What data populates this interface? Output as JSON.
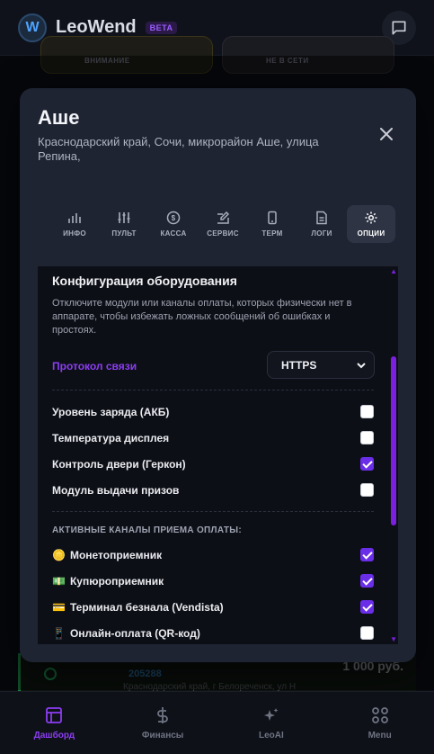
{
  "header": {
    "brand": "LeoWend",
    "beta": "BETA"
  },
  "background": {
    "status_cards": [
      {
        "label": "ВНИМАНИЕ"
      },
      {
        "label": "НЕ В СЕТИ"
      }
    ],
    "device": {
      "id": "205288",
      "price": "1 000 руб.",
      "address": "Краснодарский край, г Белореченск, ул Н"
    }
  },
  "modal": {
    "title": "Аше",
    "subtitle": "Краснодарский край, Сочи, микрорайон Аше, улица Репина,",
    "tabs": [
      {
        "label": "ИНФО",
        "icon": "bar-chart-icon"
      },
      {
        "label": "ПУЛЬТ",
        "icon": "sliders-icon"
      },
      {
        "label": "КАССА",
        "icon": "dollar-icon"
      },
      {
        "label": "СЕРВИС",
        "icon": "edit-icon"
      },
      {
        "label": "ТЕРМ",
        "icon": "phone-icon"
      },
      {
        "label": "ЛОГИ",
        "icon": "document-icon"
      },
      {
        "label": "ОПЦИИ",
        "icon": "gear-icon",
        "active": true
      }
    ],
    "config": {
      "title": "Конфигурация оборудования",
      "description": "Отключите модули или каналы оплаты, которых физически нет в аппарате, чтобы избежать ложных сообщений об ошибках и простоях.",
      "protocol_label": "Протокол связи",
      "protocol_value": "HTTPS",
      "modules": [
        {
          "label": "Уровень заряда (АКБ)",
          "checked": false
        },
        {
          "label": "Температура дисплея",
          "checked": false
        },
        {
          "label": "Контроль двери (Геркон)",
          "checked": true
        },
        {
          "label": "Модуль выдачи призов",
          "checked": false
        }
      ],
      "channels_title": "АКТИВНЫЕ КАНАЛЫ ПРИЕМА ОПЛАТЫ:",
      "channels": [
        {
          "emoji": "🪙",
          "label": "Монетоприемник",
          "checked": true
        },
        {
          "emoji": "💵",
          "label": "Купюроприемник",
          "checked": true
        },
        {
          "emoji": "💳",
          "label": "Терминал безнала (Vendista)",
          "checked": true
        },
        {
          "emoji": "📱",
          "label": "Онлайн-оплата (QR-код)",
          "checked": false
        }
      ]
    }
  },
  "nav": [
    {
      "label": "Дашборд",
      "icon": "dashboard-icon",
      "active": true
    },
    {
      "label": "Финансы",
      "icon": "dollar-icon"
    },
    {
      "label": "LeoAI",
      "icon": "sparkles-icon"
    },
    {
      "label": "Menu",
      "icon": "grid-icon"
    }
  ],
  "colors": {
    "accent": "#8b3df2",
    "checkbox_on": "#6a2ee8",
    "modal_bg": "#1f2433"
  }
}
